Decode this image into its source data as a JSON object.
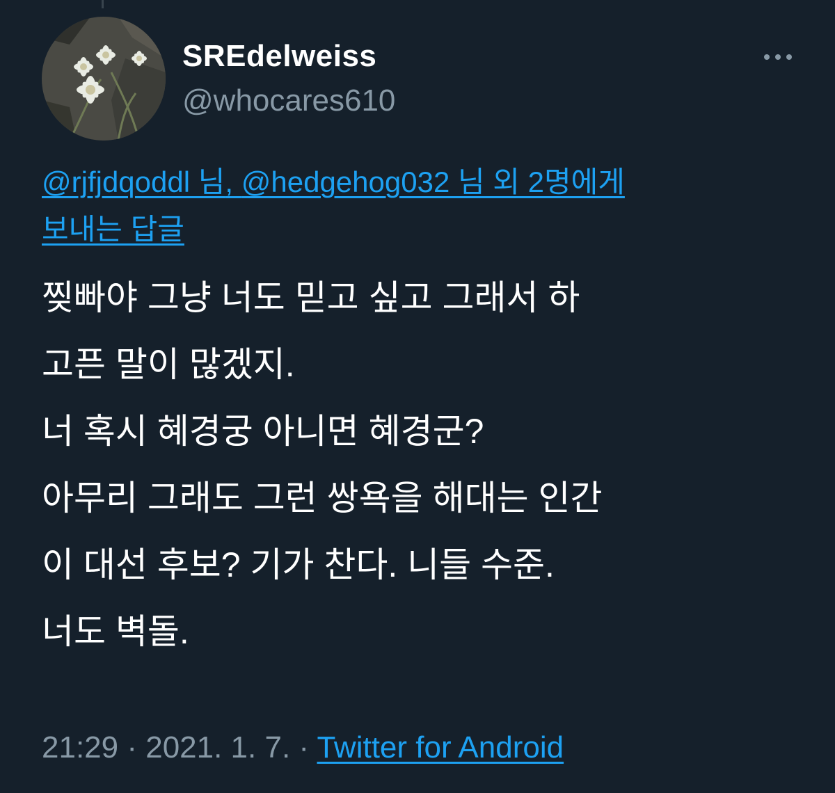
{
  "author": {
    "display_name": "SREdelweiss",
    "handle": "@whocares610",
    "avatar_icon": "edelweiss-flower-avatar"
  },
  "reply_context": {
    "mention_1": "@rjfjdqoddl 님",
    "separator": ", ",
    "mention_2": "@hedgehog032 님 외 2명에게",
    "suffix": "보내는 답글"
  },
  "tweet": {
    "lines": [
      "찢빠야 그냥 너도 믿고 싶고 그래서 하",
      "고픈 말이 많겠지.",
      "너 혹시 혜경궁 아니면 혜경군?",
      "아무리 그래도 그런 쌍욕을 해대는 인간",
      "이 대선 후보? 기가 찬다. 니들 수준.",
      "너도 벽돌."
    ]
  },
  "meta": {
    "time": "21:29",
    "date": "2021. 1. 7.",
    "separator": " · ",
    "source": "Twitter for Android"
  },
  "colors": {
    "background": "#15202b",
    "text": "#ffffff",
    "secondary": "#8899a6",
    "link": "#1da1f2"
  }
}
